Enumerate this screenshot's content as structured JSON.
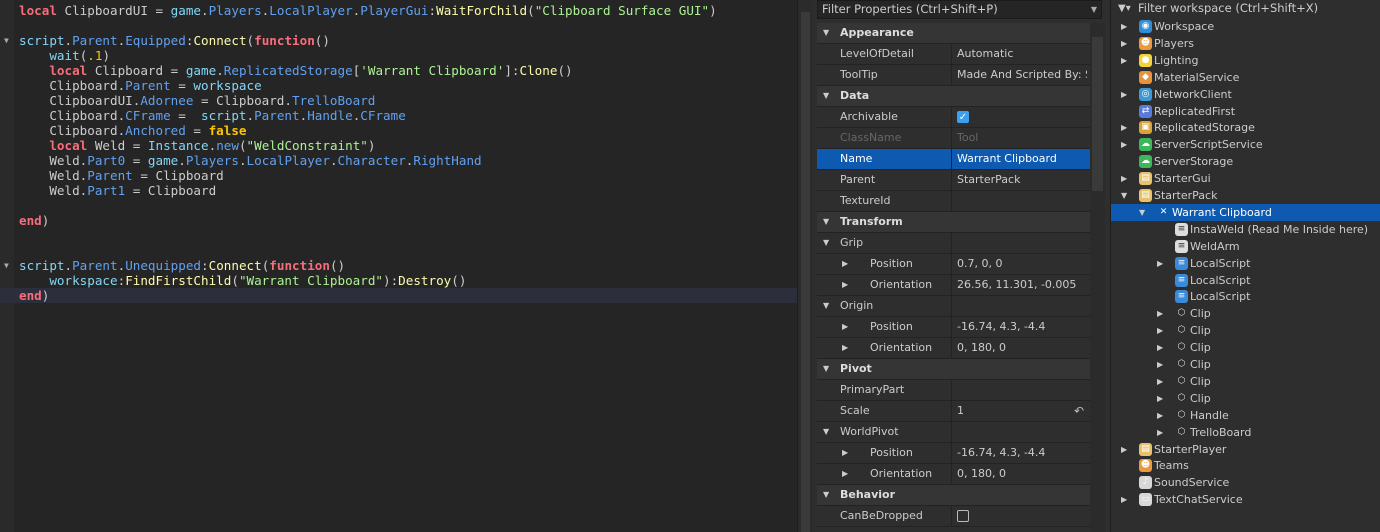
{
  "editor": {
    "lines": [
      [
        [
          "kw",
          "local"
        ],
        [
          "id",
          " ClipboardUI = "
        ],
        [
          "bi",
          "game"
        ],
        [
          "op",
          "."
        ],
        [
          "prop",
          "Players"
        ],
        [
          "op",
          "."
        ],
        [
          "prop",
          "LocalPlayer"
        ],
        [
          "op",
          "."
        ],
        [
          "prop",
          "PlayerGui"
        ],
        [
          "op",
          ":"
        ],
        [
          "fn",
          "WaitForChild"
        ],
        [
          "op",
          "("
        ],
        [
          "str",
          "\"Clipboard Surface GUI\""
        ],
        [
          "op",
          ")"
        ]
      ],
      [],
      [
        [
          "bi",
          "script"
        ],
        [
          "op",
          "."
        ],
        [
          "prop",
          "Parent"
        ],
        [
          "op",
          "."
        ],
        [
          "prop",
          "Equipped"
        ],
        [
          "op",
          ":"
        ],
        [
          "fn",
          "Connect"
        ],
        [
          "op",
          "("
        ],
        [
          "kw",
          "function"
        ],
        [
          "op",
          "()"
        ]
      ],
      [
        [
          "id",
          "    "
        ],
        [
          "bi",
          "wait"
        ],
        [
          "op",
          "("
        ],
        [
          "num",
          ".1"
        ],
        [
          "op",
          ")"
        ]
      ],
      [
        [
          "id",
          "    "
        ],
        [
          "kw",
          "local"
        ],
        [
          "id",
          " Clipboard = "
        ],
        [
          "bi",
          "game"
        ],
        [
          "op",
          "."
        ],
        [
          "prop",
          "ReplicatedStorage"
        ],
        [
          "op",
          "["
        ],
        [
          "str",
          "'Warrant Clipboard'"
        ],
        [
          "op",
          "]:"
        ],
        [
          "fn",
          "Clone"
        ],
        [
          "op",
          "()"
        ]
      ],
      [
        [
          "id",
          "    Clipboard."
        ],
        [
          "prop",
          "Parent"
        ],
        [
          "id",
          " = "
        ],
        [
          "bi",
          "workspace"
        ]
      ],
      [
        [
          "id",
          "    ClipboardUI."
        ],
        [
          "prop",
          "Adornee"
        ],
        [
          "id",
          " = Clipboard."
        ],
        [
          "prop",
          "TrelloBoard"
        ]
      ],
      [
        [
          "id",
          "    Clipboard."
        ],
        [
          "prop",
          "CFrame"
        ],
        [
          "id",
          " =  "
        ],
        [
          "bi",
          "script"
        ],
        [
          "op",
          "."
        ],
        [
          "prop",
          "Parent"
        ],
        [
          "op",
          "."
        ],
        [
          "prop",
          "Handle"
        ],
        [
          "op",
          "."
        ],
        [
          "prop",
          "CFrame"
        ]
      ],
      [
        [
          "id",
          "    Clipboard."
        ],
        [
          "prop",
          "Anchored"
        ],
        [
          "id",
          " = "
        ],
        [
          "bool",
          "false"
        ]
      ],
      [
        [
          "id",
          "    "
        ],
        [
          "kw",
          "local"
        ],
        [
          "id",
          " Weld = "
        ],
        [
          "bi",
          "Instance"
        ],
        [
          "op",
          "."
        ],
        [
          "prop",
          "new"
        ],
        [
          "op",
          "("
        ],
        [
          "str",
          "\"WeldConstraint\""
        ],
        [
          "op",
          ")"
        ]
      ],
      [
        [
          "id",
          "    Weld."
        ],
        [
          "prop",
          "Part0"
        ],
        [
          "id",
          " = "
        ],
        [
          "bi",
          "game"
        ],
        [
          "op",
          "."
        ],
        [
          "prop",
          "Players"
        ],
        [
          "op",
          "."
        ],
        [
          "prop",
          "LocalPlayer"
        ],
        [
          "op",
          "."
        ],
        [
          "prop",
          "Character"
        ],
        [
          "op",
          "."
        ],
        [
          "prop",
          "RightHand"
        ]
      ],
      [
        [
          "id",
          "    Weld."
        ],
        [
          "prop",
          "Parent"
        ],
        [
          "id",
          " = Clipboard"
        ]
      ],
      [
        [
          "id",
          "    Weld."
        ],
        [
          "prop",
          "Part1"
        ],
        [
          "id",
          " = Clipboard"
        ]
      ],
      [],
      [
        [
          "kw",
          "end"
        ],
        [
          "op",
          ")"
        ]
      ],
      [],
      [],
      [
        [
          "bi",
          "script"
        ],
        [
          "op",
          "."
        ],
        [
          "prop",
          "Parent"
        ],
        [
          "op",
          "."
        ],
        [
          "prop",
          "Unequipped"
        ],
        [
          "op",
          ":"
        ],
        [
          "fn",
          "Connect"
        ],
        [
          "op",
          "("
        ],
        [
          "kw",
          "function"
        ],
        [
          "op",
          "()"
        ]
      ],
      [
        [
          "id",
          "    "
        ],
        [
          "bi",
          "workspace"
        ],
        [
          "op",
          ":"
        ],
        [
          "fn",
          "FindFirstChild"
        ],
        [
          "op",
          "("
        ],
        [
          "str",
          "\"Warrant Clipboard\""
        ],
        [
          "op",
          "):"
        ],
        [
          "fn",
          "Destroy"
        ],
        [
          "op",
          "()"
        ]
      ],
      [
        [
          "kw",
          "end"
        ],
        [
          "op",
          ")"
        ]
      ]
    ],
    "fold_lines": [
      2,
      17
    ],
    "current_line": 19
  },
  "properties": {
    "filter_placeholder": "Filter Properties (Ctrl+Shift+P)",
    "rows": [
      {
        "type": "cat",
        "name": "Appearance"
      },
      {
        "name": "LevelOfDetail",
        "value": "Automatic"
      },
      {
        "name": "ToolTip",
        "value": "Made And Scripted By: S..."
      },
      {
        "type": "cat",
        "name": "Data"
      },
      {
        "name": "Archivable",
        "check": true
      },
      {
        "name": "ClassName",
        "value": "Tool",
        "disabled": true
      },
      {
        "name": "Name",
        "value": "Warrant Clipboard",
        "selected": true
      },
      {
        "name": "Parent",
        "value": "StarterPack"
      },
      {
        "name": "TextureId",
        "value": ""
      },
      {
        "type": "cat",
        "name": "Transform"
      },
      {
        "name": "Grip",
        "group": true
      },
      {
        "name": "Position",
        "value": "0.7, 0, 0",
        "sub": true
      },
      {
        "name": "Orientation",
        "value": "26.56, 11.301, -0.005",
        "sub": true
      },
      {
        "name": "Origin",
        "group": true
      },
      {
        "name": "Position",
        "value": "-16.74, 4.3, -4.4",
        "sub": true
      },
      {
        "name": "Orientation",
        "value": "0, 180, 0",
        "sub": true
      },
      {
        "type": "cat",
        "name": "Pivot"
      },
      {
        "name": "PrimaryPart",
        "value": ""
      },
      {
        "name": "Scale",
        "value": "1",
        "reset": true
      },
      {
        "name": "WorldPivot",
        "group": true
      },
      {
        "name": "Position",
        "value": "-16.74, 4.3, -4.4",
        "sub": true
      },
      {
        "name": "Orientation",
        "value": "0, 180, 0",
        "sub": true
      },
      {
        "type": "cat",
        "name": "Behavior"
      },
      {
        "name": "CanBeDropped",
        "check": false
      }
    ]
  },
  "explorer": {
    "filter_placeholder": "Filter workspace (Ctrl+Shift+X)",
    "items": [
      {
        "label": "Workspace",
        "depth": 0,
        "arrow": "right",
        "icon": "globe-icon",
        "color": "#2f8fd8"
      },
      {
        "label": "Players",
        "depth": 0,
        "arrow": "right",
        "icon": "players-icon",
        "color": "#e89a3c"
      },
      {
        "label": "Lighting",
        "depth": 0,
        "arrow": "right",
        "icon": "lightbulb-icon",
        "color": "#f2d43a"
      },
      {
        "label": "MaterialService",
        "depth": 0,
        "arrow": "",
        "icon": "material-service-icon",
        "color": "#e8923c"
      },
      {
        "label": "NetworkClient",
        "depth": 0,
        "arrow": "right",
        "icon": "network-icon",
        "color": "#3a9ad8"
      },
      {
        "label": "ReplicatedFirst",
        "depth": 0,
        "arrow": "",
        "icon": "replicated-first-icon",
        "color": "#5a7ad8"
      },
      {
        "label": "ReplicatedStorage",
        "depth": 0,
        "arrow": "right",
        "icon": "replicated-storage-icon",
        "color": "#d8a23c"
      },
      {
        "label": "ServerScriptService",
        "depth": 0,
        "arrow": "right",
        "icon": "server-script-icon",
        "color": "#3cb85a"
      },
      {
        "label": "ServerStorage",
        "depth": 0,
        "arrow": "",
        "icon": "server-storage-icon",
        "color": "#3cb85a"
      },
      {
        "label": "StarterGui",
        "depth": 0,
        "arrow": "right",
        "icon": "starter-gui-icon",
        "color": "#e8c26a"
      },
      {
        "label": "StarterPack",
        "depth": 0,
        "arrow": "down",
        "icon": "starter-pack-icon",
        "color": "#e8c26a"
      },
      {
        "label": "Warrant Clipboard",
        "depth": 1,
        "arrow": "down",
        "icon": "tool-icon",
        "color": "#0d5ab0",
        "selected": true
      },
      {
        "label": "InstaWeld (Read Me Inside here)",
        "depth": 2,
        "arrow": "",
        "icon": "script-icon",
        "color": "#d8d8d8"
      },
      {
        "label": "WeldArm",
        "depth": 2,
        "arrow": "",
        "icon": "script-icon",
        "color": "#d8d8d8"
      },
      {
        "label": "LocalScript",
        "depth": 2,
        "arrow": "right",
        "icon": "local-script-icon",
        "color": "#3a8ad8"
      },
      {
        "label": "LocalScript",
        "depth": 2,
        "arrow": "",
        "icon": "local-script-icon",
        "color": "#3a8ad8"
      },
      {
        "label": "LocalScript",
        "depth": 2,
        "arrow": "",
        "icon": "local-script-icon",
        "color": "#3a8ad8"
      },
      {
        "label": "Clip",
        "depth": 2,
        "arrow": "right",
        "icon": "part-icon",
        "color": "#555"
      },
      {
        "label": "Clip",
        "depth": 2,
        "arrow": "right",
        "icon": "part-icon",
        "color": "#555"
      },
      {
        "label": "Clip",
        "depth": 2,
        "arrow": "right",
        "icon": "part-icon",
        "color": "#555"
      },
      {
        "label": "Clip",
        "depth": 2,
        "arrow": "right",
        "icon": "part-icon",
        "color": "#555"
      },
      {
        "label": "Clip",
        "depth": 2,
        "arrow": "right",
        "icon": "part-icon",
        "color": "#555"
      },
      {
        "label": "Clip",
        "depth": 2,
        "arrow": "right",
        "icon": "part-icon",
        "color": "#555"
      },
      {
        "label": "Handle",
        "depth": 2,
        "arrow": "right",
        "icon": "part-icon",
        "color": "#555"
      },
      {
        "label": "TrelloBoard",
        "depth": 2,
        "arrow": "right",
        "icon": "part-icon",
        "color": "#555"
      },
      {
        "label": "StarterPlayer",
        "depth": 0,
        "arrow": "right",
        "icon": "starter-player-icon",
        "color": "#e8c26a"
      },
      {
        "label": "Teams",
        "depth": 0,
        "arrow": "",
        "icon": "teams-icon",
        "color": "#e89a3c"
      },
      {
        "label": "SoundService",
        "depth": 0,
        "arrow": "",
        "icon": "sound-icon",
        "color": "#d8d8d8"
      },
      {
        "label": "TextChatService",
        "depth": 0,
        "arrow": "right",
        "icon": "chat-icon",
        "color": "#d8d8d8"
      }
    ]
  }
}
